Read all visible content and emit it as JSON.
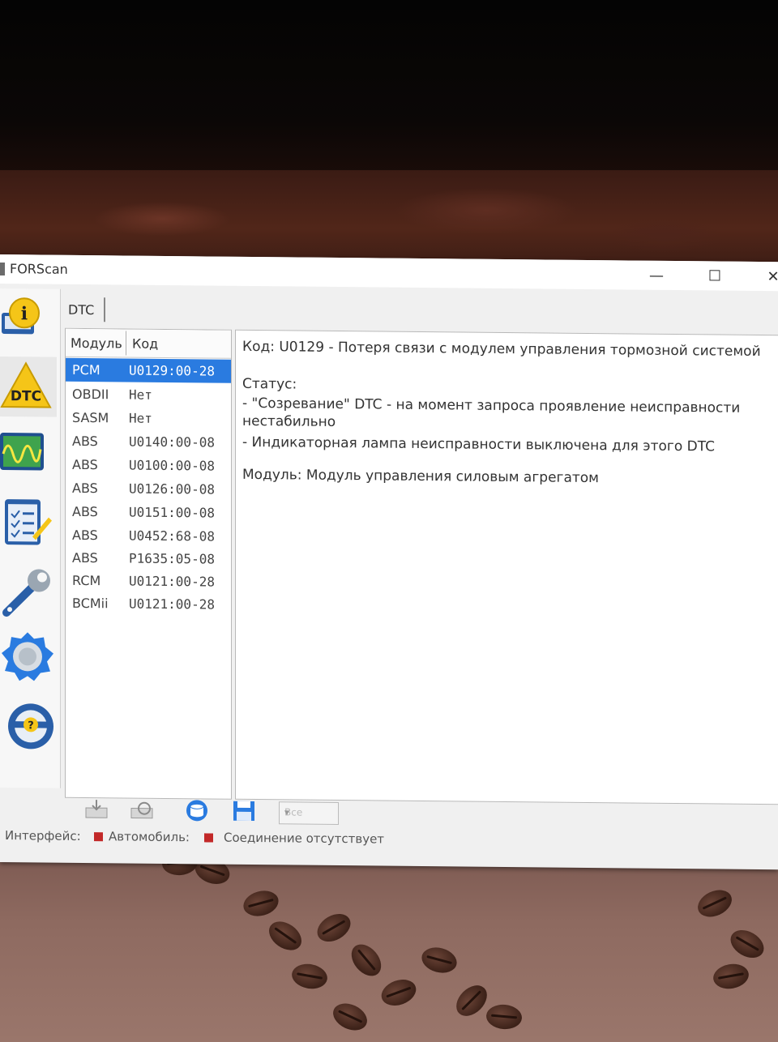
{
  "window": {
    "title": "FORScan",
    "minimize_glyph": "—",
    "maximize_glyph": "☐",
    "close_glyph": "✕"
  },
  "sidebar": {
    "items": [
      {
        "name": "info",
        "icon": "info-icon"
      },
      {
        "name": "dtc",
        "icon": "dtc-warning-icon",
        "label": "DTC"
      },
      {
        "name": "oscilloscope",
        "icon": "oscilloscope-icon"
      },
      {
        "name": "checklist",
        "icon": "checklist-icon"
      },
      {
        "name": "service",
        "icon": "wrench-icon"
      },
      {
        "name": "settings",
        "icon": "gear-icon"
      },
      {
        "name": "help",
        "icon": "help-wheel-icon",
        "label": "?"
      }
    ]
  },
  "tab": {
    "label": "DTC"
  },
  "dtc_table": {
    "headers": [
      "Модуль",
      "Код"
    ],
    "rows": [
      {
        "module": "PCM",
        "code": "U0129:00-28",
        "selected": true
      },
      {
        "module": "OBDII",
        "code": "Нет"
      },
      {
        "module": "SASM",
        "code": "Нет"
      },
      {
        "module": "ABS",
        "code": "U0140:00-08"
      },
      {
        "module": "ABS",
        "code": "U0100:00-08"
      },
      {
        "module": "ABS",
        "code": "U0126:00-08"
      },
      {
        "module": "ABS",
        "code": "U0151:00-08"
      },
      {
        "module": "ABS",
        "code": "U0452:68-08"
      },
      {
        "module": "ABS",
        "code": "P1635:05-08"
      },
      {
        "module": "RCM",
        "code": "U0121:00-28"
      },
      {
        "module": "BCMii",
        "code": "U0121:00-28"
      }
    ]
  },
  "details": {
    "code_line": "Код: U0129 - Потеря связи с модулем управления тормозной системой",
    "status_label": "Статус:",
    "status_line1": " - \"Созревание\" DTC - на момент запроса проявление неисправности",
    "status_line1_cont": "нестабильно",
    "status_line2": " - Индикаторная лампа неисправности выключена для этого DTC",
    "module_line": "Модуль: Модуль управления силовым агрегатом"
  },
  "bottom_toolbar": {
    "buttons": [
      "read-icon",
      "clear-icon",
      "database-icon",
      "save-icon"
    ],
    "select_value": "Все"
  },
  "statusbar": {
    "interface_label": "Интерфейс:",
    "vehicle_label": "Автомобиль:",
    "connection_text": "Соединение отсутствует",
    "led_color": "#c22828"
  },
  "colors": {
    "selection": "#2a7be0",
    "accent_blue": "#1f6fc1"
  }
}
